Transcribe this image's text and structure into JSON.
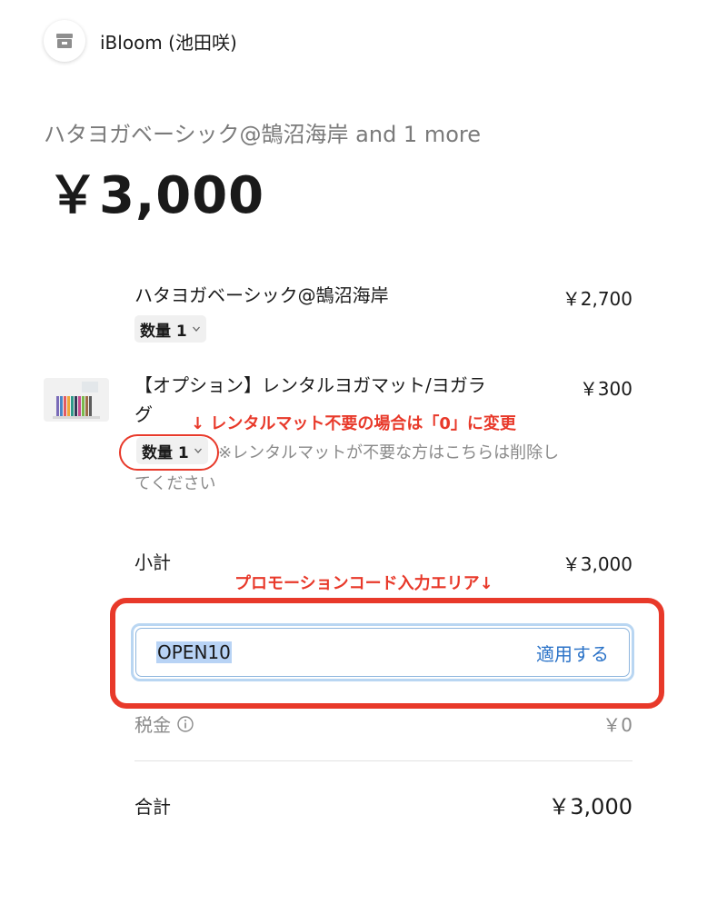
{
  "merchant": {
    "name": "iBloom (池田咲)"
  },
  "summary": {
    "title": "ハタヨガベーシック@鵠沼海岸 and 1 more",
    "total": "￥3,000"
  },
  "items": [
    {
      "name": "ハタヨガベーシック@鵠沼海岸",
      "price": "￥2,700",
      "qty_label": "数量 1"
    },
    {
      "name_line1": "【オプション】レンタルヨガマット/ヨガラ",
      "name_line2": "グ",
      "price": "￥300",
      "qty_label": "数量 1",
      "note_line1": "※レンタルマットが不要な方はこちらは削除し",
      "note_line2": "てください"
    }
  ],
  "annotations": {
    "mat_hint": "↓ レンタルマット不要の場合は「0」に変更",
    "promo_hint": "プロモーションコード入力エリア↓"
  },
  "subtotal": {
    "label": "小計",
    "value": "￥3,000"
  },
  "promo": {
    "value": "OPEN10",
    "apply_label": "適用する"
  },
  "tax": {
    "label": "税金",
    "value": "￥0"
  },
  "total": {
    "label": "合計",
    "value": "￥3,000"
  },
  "colors": {
    "annotation_red": "#e8392a",
    "link_blue": "#2b73c8",
    "selection": "#b8d3f5"
  },
  "icons": {
    "merchant": "store-icon",
    "qty_chevron": "chevron-down-icon",
    "tax_info": "info-icon"
  }
}
